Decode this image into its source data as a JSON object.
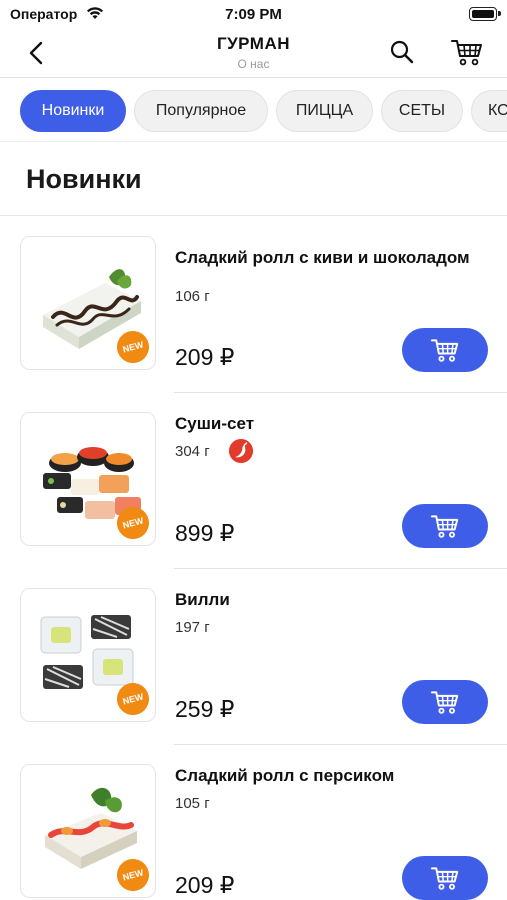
{
  "status_bar": {
    "carrier": "Оператор",
    "time": "7:09 PM"
  },
  "nav": {
    "title": "ГУРМАН",
    "subtitle": "О нас"
  },
  "tabs": [
    {
      "label": "Новинки",
      "active": true
    },
    {
      "label": "Популярное",
      "active": false
    },
    {
      "label": "ПИЦЦА",
      "active": false
    },
    {
      "label": "СЕТЫ",
      "active": false
    },
    {
      "label": "КО",
      "active": false
    }
  ],
  "section": {
    "title": "Новинки"
  },
  "products": [
    {
      "name": "Сладкий ролл с киви и шоколадом",
      "weight": "106 г",
      "price": "209 ₽",
      "badge": "NEW",
      "spicy": false
    },
    {
      "name": "Суши-сет",
      "weight": "304 г",
      "price": "899 ₽",
      "badge": "NEW",
      "spicy": true
    },
    {
      "name": "Вилли",
      "weight": "197 г",
      "price": "259 ₽",
      "badge": "NEW",
      "spicy": false
    },
    {
      "name": "Сладкий ролл с персиком",
      "weight": "105 г",
      "price": "209 ₽",
      "badge": "NEW",
      "spicy": false
    }
  ],
  "colors": {
    "accent": "#3f5ee8",
    "badge": "#f18a12",
    "spicy": "#e23b2b"
  },
  "icons": {
    "back": "chevron-left-icon",
    "search": "search-icon",
    "cart": "cart-icon",
    "spicy": "chili-pepper-icon"
  }
}
